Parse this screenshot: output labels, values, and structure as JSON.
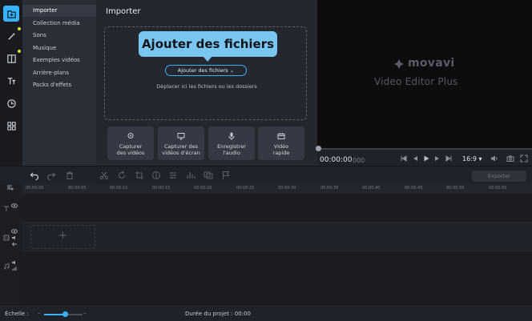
{
  "sidebar_tabs": {
    "import": "Importer",
    "media": "Collection média",
    "sounds": "Sons",
    "music": "Musique",
    "sample_videos": "Exemples vidéos",
    "backgrounds": "Arrière-plans",
    "effect_packs": "Packs d'effets"
  },
  "import_panel": {
    "title": "Importer",
    "add_files_button": "Ajouter des fichiers",
    "drop_hint": "Déplacer ici les fichiers ou les dossiers",
    "capture_video": [
      "Capturer",
      "des vidéos"
    ],
    "capture_screen": [
      "Capturer des",
      "vidéos d'écran"
    ],
    "record_audio": [
      "Enregistrer",
      "l'audio"
    ],
    "quick_video": [
      "Vidéo",
      "rapide"
    ]
  },
  "tooltip": {
    "text": "Ajouter des fichiers"
  },
  "player": {
    "logo_text": "movavi",
    "logo_subtitle": "Video Editor Plus",
    "timecode": "00:00:00",
    "timecode_ms": "000",
    "aspect_ratio": "16:9 ▾"
  },
  "toolbar": {
    "export_label": "Exporter"
  },
  "ruler": {
    "labels": [
      "00:00:00",
      "00:00:05",
      "00:00:10",
      "00:00:15",
      "00:00:20",
      "00:00:25",
      "00:00:30",
      "00:00:35",
      "00:00:40",
      "00:00:45",
      "00:00:50",
      "00:00:55"
    ]
  },
  "timeline": {
    "drop_placeholder": "+"
  },
  "statusbar": {
    "scale_label": "Échelle :",
    "duration": "Durée du projet :  00:00"
  },
  "colors": {
    "accent": "#38b4ff",
    "tooltip_bg": "#79c6f1",
    "new_dot": "#d6e22a"
  }
}
